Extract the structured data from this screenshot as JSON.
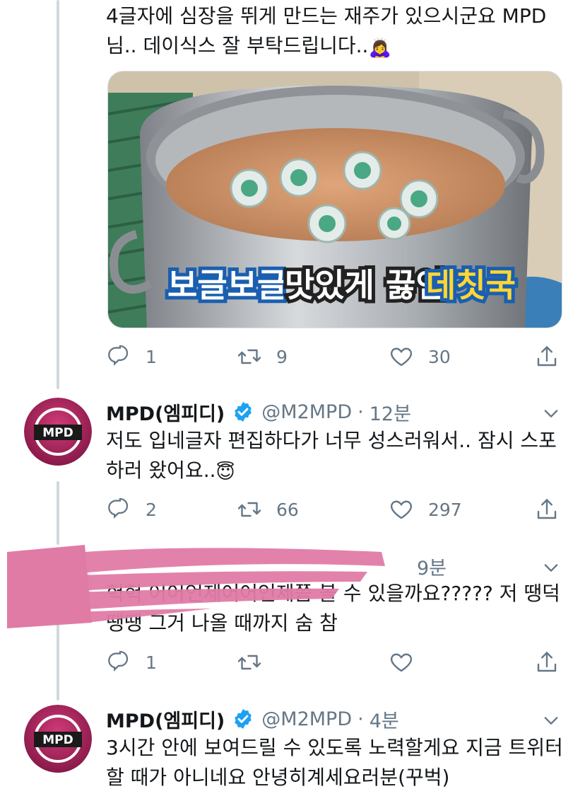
{
  "tweets": [
    {
      "text": "4글자에 심장을 뛰게 만드는 재주가 있으시군요 MPD 님.. 데이식스 잘 부탁드립니다..",
      "emoji": "🙇‍♀️",
      "media": {
        "caption_a": "보글보글",
        "caption_b": "맛있게 끓인",
        "caption_c": "데칫국"
      },
      "replies": "1",
      "retweets": "9",
      "likes": "30"
    },
    {
      "name": "MPD(엠피디)",
      "handle": "@M2MPD",
      "dot": "·",
      "time": "12분",
      "text": "저도 입네글자 편집하다가 너무 성스러워서.. 잠시 스포하러 왔어요..",
      "emoji": "😇",
      "avatar_label": "MPD",
      "replies": "2",
      "retweets": "66",
      "likes": "297"
    },
    {
      "time": "9분",
      "text": "헉헉 어어언제어어언제쯤 볼 수 있을까요????? 저 땡덕땡땡 그거 나올 때까지 숨 참",
      "replies": "1",
      "retweets": "",
      "likes": ""
    },
    {
      "name": "MPD(엠피디)",
      "handle": "@M2MPD",
      "dot": "·",
      "time": "4분",
      "text": "3시간 안에 보여드릴 수 있도록 노력할게요 지금 트위터 할 때가 아니네요 안녕히계세요러분(꾸벅)",
      "avatar_label": "MPD"
    }
  ],
  "icons": {
    "reply": "reply-icon",
    "retweet": "retweet-icon",
    "like": "heart-icon",
    "share": "share-icon",
    "more": "chevron-down-icon",
    "verified": "verified-badge-icon"
  },
  "colors": {
    "text": "#14171a",
    "secondary": "#657786",
    "verified": "#1da1f2",
    "thread_line": "#cfd9de",
    "scribble": "#e07ba5"
  }
}
